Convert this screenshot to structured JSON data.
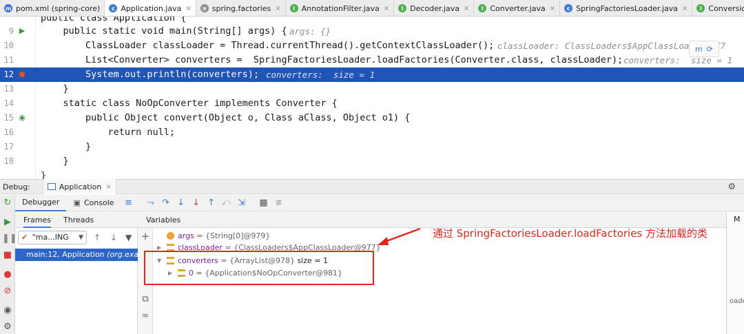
{
  "tabs": [
    {
      "label": "pom.xml (spring-core)",
      "icon": "maven-icon",
      "active": false,
      "close": false
    },
    {
      "label": "Application.java",
      "icon": "class-icon",
      "active": true,
      "close": true
    },
    {
      "label": "spring.factories",
      "icon": "file-icon",
      "active": false,
      "close": true
    },
    {
      "label": "AnnotationFilter.java",
      "icon": "interface-icon",
      "active": false,
      "close": true
    },
    {
      "label": "Decoder.java",
      "icon": "interface-icon",
      "active": false,
      "close": true
    },
    {
      "label": "Converter.java",
      "icon": "interface-icon",
      "active": false,
      "close": true
    },
    {
      "label": "SpringFactoriesLoader.java",
      "icon": "class-icon",
      "active": false,
      "close": true
    },
    {
      "label": "ConversionService.java",
      "icon": "interface-icon",
      "active": false,
      "close": true
    }
  ],
  "colors": {
    "accent": "#3a7bd5",
    "highlight": "#2154b7",
    "annotation": "#e1261c",
    "breakpoint": "#d9531e"
  },
  "editor": {
    "lines": [
      {
        "num": "",
        "code": "public class Application {",
        "hint": ""
      },
      {
        "num": "9",
        "code": "    public static void main(String[] args) {",
        "hint": "args: {}"
      },
      {
        "num": "10",
        "code": "        ClassLoader classLoader = Thread.currentThread().getContextClassLoader();",
        "hint": "classLoader: ClassLoaders$AppClassLoader@977"
      },
      {
        "num": "11",
        "code": "        List<Converter> converters =  SpringFactoriesLoader.loadFactories(Converter.class, classLoader);",
        "hint": "converters:  size = 1"
      },
      {
        "num": "12",
        "code": "        System.out.println(converters);",
        "hint": "converters:  size = 1"
      },
      {
        "num": "13",
        "code": "    }",
        "hint": ""
      },
      {
        "num": "14",
        "code": "    static class NoOpConverter implements Converter {",
        "hint": ""
      },
      {
        "num": "15",
        "code": "        public Object convert(Object o, Class aClass, Object o1) {",
        "hint": ""
      },
      {
        "num": "16",
        "code": "            return null;",
        "hint": ""
      },
      {
        "num": "17",
        "code": "        }",
        "hint": ""
      },
      {
        "num": "18",
        "code": "    }",
        "hint": ""
      },
      {
        "num": "",
        "code": "}",
        "hint": ""
      }
    ]
  },
  "debug": {
    "label": "Debug:",
    "config_tab": "Application",
    "config_close": "×",
    "toolbar_tabs": [
      "Debugger",
      "Console"
    ],
    "frames_header": "Frames",
    "threads_header": "Threads",
    "variables_header": "Variables",
    "thread_select": "\"ma...ING",
    "frame_row_main": "main:12, Application",
    "frame_row_pkg": "(org.exa",
    "right_header": "M",
    "right_text": "oaded"
  },
  "variables": [
    {
      "name": "args",
      "value": "= {String[0]@979}",
      "expandable": false,
      "expanded": false,
      "indent": 0,
      "icon": "param-icon"
    },
    {
      "name": "classLoader",
      "value": "= {ClassLoaders$AppClassLoader@977}",
      "expandable": true,
      "expanded": false,
      "indent": 0,
      "icon": "field-icon"
    },
    {
      "name": "converters",
      "value": "= {ArrayList@978}",
      "size": "size = 1",
      "expandable": true,
      "expanded": true,
      "indent": 0,
      "icon": "field-icon"
    },
    {
      "name": "0",
      "value": "= {Application$NoOpConverter@981}",
      "expandable": true,
      "expanded": false,
      "indent": 1,
      "icon": "field-icon"
    }
  ],
  "annotation": {
    "text": "通过 SpringFactoriesLoader.loadFactories 方法加载的类"
  }
}
